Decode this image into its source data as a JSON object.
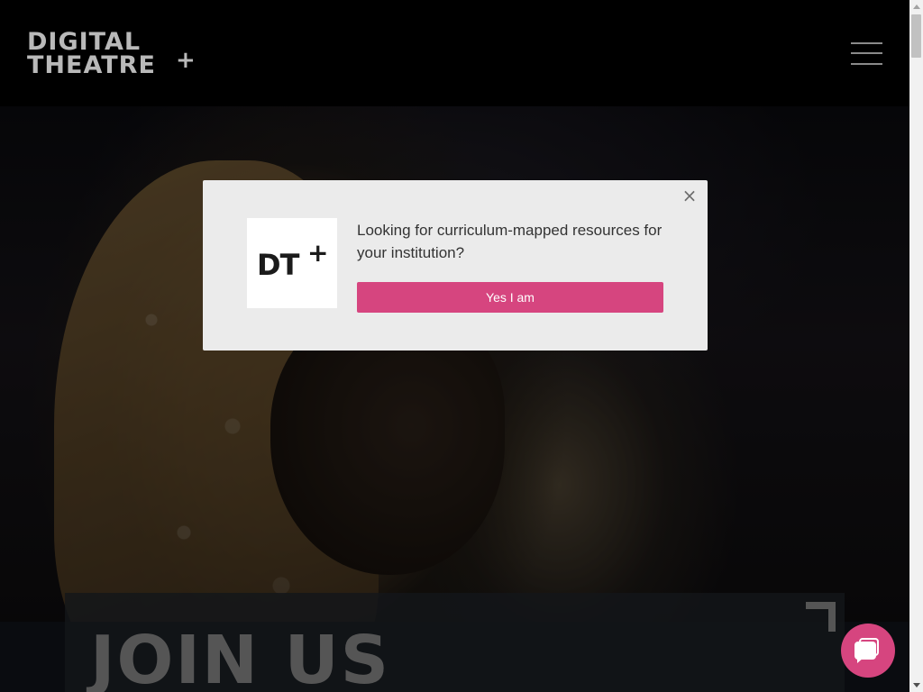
{
  "header": {
    "logo_line1": "DIGITAL",
    "logo_line2": "THEATRE",
    "logo_plus": "+"
  },
  "hero": {
    "panel_title": "JOIN US"
  },
  "modal": {
    "logo_text": "DT",
    "logo_plus": "+",
    "close_glyph": "×",
    "message": "Looking for curriculum-mapped resources for your institution?",
    "cta_label": "Yes I am"
  },
  "colors": {
    "accent": "#d6457f",
    "modal_bg": "#ebebeb",
    "header_bg": "#000000",
    "logo_gray": "#b9b9b9"
  },
  "icons": {
    "menu": "hamburger-icon",
    "close": "close-icon",
    "chat": "chat-icon"
  }
}
